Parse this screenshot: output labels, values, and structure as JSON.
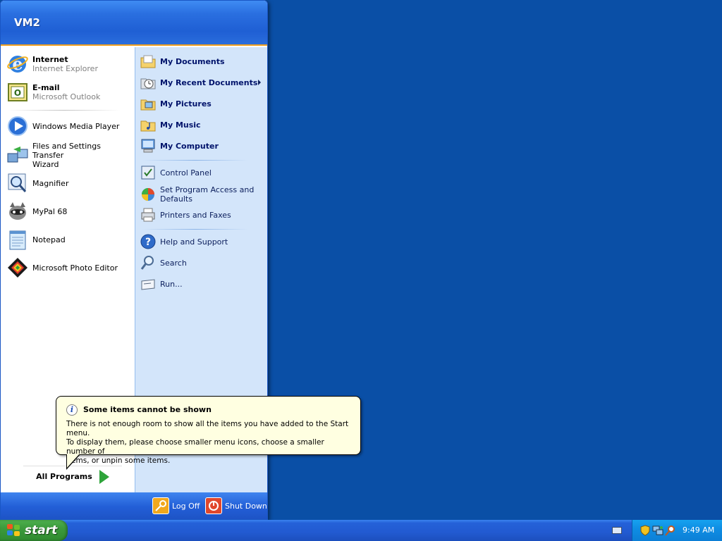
{
  "user": "VM2",
  "pinned": [
    {
      "name": "Internet",
      "sub": "Internet Explorer",
      "icon": "internet-explorer-icon"
    },
    {
      "name": "E-mail",
      "sub": "Microsoft Outlook",
      "icon": "outlook-icon"
    }
  ],
  "recent": [
    {
      "line1": "Windows Media Player",
      "line2": "",
      "icon": "media-player-icon"
    },
    {
      "line1": "Files and Settings Transfer",
      "line2": "Wizard",
      "icon": "transfer-wizard-icon"
    },
    {
      "line1": "Magnifier",
      "line2": "",
      "icon": "magnifier-icon"
    },
    {
      "line1": "MyPal 68",
      "line2": "",
      "icon": "mypal-icon"
    },
    {
      "line1": "Notepad",
      "line2": "",
      "icon": "notepad-icon"
    },
    {
      "line1": "Microsoft Photo Editor",
      "line2": "",
      "icon": "photo-editor-icon"
    }
  ],
  "all_programs": "All Programs",
  "places": [
    {
      "line1": "My Documents",
      "line2": "",
      "icon": "folder-icon"
    },
    {
      "line1": "My Recent Documents",
      "line2": "",
      "icon": "recent-documents-icon"
    },
    {
      "line1": "My Pictures",
      "line2": "",
      "icon": "pictures-folder-icon"
    },
    {
      "line1": "My Music",
      "line2": "",
      "icon": "music-folder-icon"
    },
    {
      "line1": "My Computer",
      "line2": "",
      "icon": "computer-icon"
    }
  ],
  "system": [
    {
      "line1": "Control Panel",
      "line2": "",
      "icon": "control-panel-icon"
    },
    {
      "line1": "Set Program Access and",
      "line2": "Defaults",
      "icon": "program-access-icon"
    },
    {
      "line1": "Printers and Faxes",
      "line2": "",
      "icon": "printer-icon"
    }
  ],
  "help": [
    {
      "line1": "Help and Support",
      "line2": "",
      "icon": "help-icon"
    },
    {
      "line1": "Search",
      "line2": "",
      "icon": "search-icon"
    },
    {
      "line1": "Run...",
      "line2": "",
      "icon": "run-icon"
    }
  ],
  "footer": {
    "logoff": "Log Off",
    "shutdown": "Shut Down"
  },
  "balloon": {
    "title": "Some items cannot be shown",
    "line1": "There is not enough room to show all the items you have added to the Start menu.",
    "line2": "To display them, please choose smaller menu icons, choose a smaller number of",
    "line3": "items, or unpin some items."
  },
  "taskbar": {
    "start": "start",
    "clock": "9:49 AM"
  },
  "colors": {
    "desktop": "#0a4fa6",
    "menu_header": "#1f5fd4",
    "places_bg": "#d3e5fa",
    "start_green": "#3c9a3c",
    "balloon_bg": "#ffffe1"
  }
}
